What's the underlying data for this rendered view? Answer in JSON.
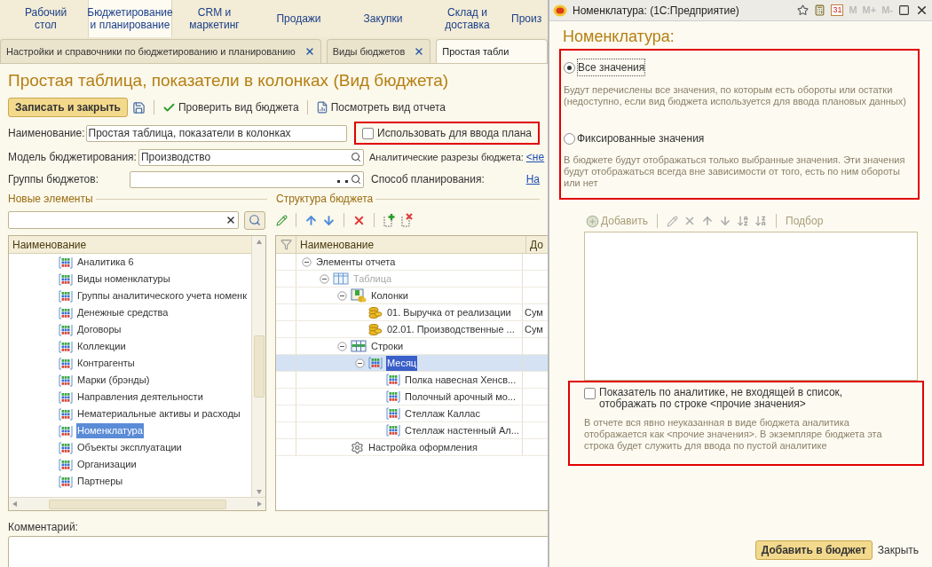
{
  "sections": [
    {
      "label": "Рабочий\nстол",
      "selected": false
    },
    {
      "label": "Бюджетирование\nи планирование",
      "selected": true
    },
    {
      "label": "CRM и\nмаркетинг",
      "selected": false
    },
    {
      "label": "Продажи",
      "selected": false
    },
    {
      "label": "Закупки",
      "selected": false
    },
    {
      "label": "Склад и\nдоставка",
      "selected": false
    },
    {
      "label": "Произ",
      "selected": false
    }
  ],
  "tabs": [
    {
      "label": "Настройки и справочники по бюджетированию и планированию",
      "closable": true,
      "selected": false
    },
    {
      "label": "Виды  бюджетов",
      "closable": true,
      "selected": false
    },
    {
      "label": "Простая табли",
      "closable": false,
      "selected": true
    }
  ],
  "form": {
    "title": "Простая таблица, показатели в колонках (Вид бюджета)",
    "toolbar": {
      "save_close": "Записать и закрыть",
      "check": "Проверить вид бюджета",
      "view": "Посмотреть вид отчета"
    },
    "name": {
      "label": "Наименование:",
      "value": "Простая таблица, показатели в колонках"
    },
    "use_for_plan": {
      "label": "Использовать для ввода плана",
      "checked": false
    },
    "model": {
      "label": "Модель бюджетирования:",
      "value": "Производство"
    },
    "analytics": {
      "label": "Аналитические разрезы бюджета:",
      "link": "<не"
    },
    "group": {
      "label": "Группы бюджетов:"
    },
    "planning": {
      "label": "Способ планирования:",
      "link": "На"
    },
    "comment": {
      "label": "Комментарий:"
    }
  },
  "new_elements": {
    "heading": "Новые элементы",
    "column": "Наименование",
    "items": [
      {
        "label": "Аналитика 6",
        "selected": false
      },
      {
        "label": "Виды номенклатуры",
        "selected": false
      },
      {
        "label": "Группы аналитического учета номенк",
        "selected": false
      },
      {
        "label": "Денежные средства",
        "selected": false
      },
      {
        "label": "Договоры",
        "selected": false
      },
      {
        "label": "Коллекции",
        "selected": false
      },
      {
        "label": "Контрагенты",
        "selected": false
      },
      {
        "label": "Марки (брэнды)",
        "selected": false
      },
      {
        "label": "Направления деятельности",
        "selected": false
      },
      {
        "label": "Нематериальные активы и расходы",
        "selected": false
      },
      {
        "label": "Номенклатура",
        "selected": true
      },
      {
        "label": "Объекты эксплуатации",
        "selected": false
      },
      {
        "label": "Организации",
        "selected": false
      },
      {
        "label": "Партнеры",
        "selected": false
      }
    ]
  },
  "structure": {
    "heading": "Структура бюджета",
    "columns": [
      "Наименование",
      "До"
    ],
    "rows": [
      {
        "label": "Элементы отчета",
        "expanded": true,
        "disabled": false,
        "selected": false,
        "children": [
          {
            "label": "Таблица",
            "kind": "table",
            "expanded": true,
            "disabled": true,
            "selected": false,
            "children": [
              {
                "label": "Колонки",
                "kind": "columns",
                "expanded": true,
                "disabled": false,
                "selected": false,
                "children": [
                  {
                    "label": "01. Выручка от реализации",
                    "kind": "indicator",
                    "column_2": "Сум",
                    "disabled": false,
                    "selected": false
                  },
                  {
                    "label": "02.01. Производственные ...",
                    "kind": "indicator",
                    "column_2": "Сум",
                    "disabled": false,
                    "selected": false
                  }
                ]
              },
              {
                "label": "Строки",
                "kind": "rows",
                "expanded": true,
                "disabled": false,
                "selected": false,
                "children": [
                  {
                    "label": "Месяц",
                    "kind": "analytics",
                    "expanded": true,
                    "disabled": false,
                    "selected": true,
                    "children": [
                      {
                        "label": "Полка навесная Хенсв...",
                        "kind": "analytics",
                        "disabled": false,
                        "selected": false
                      },
                      {
                        "label": "Полочный арочный мо...",
                        "kind": "analytics",
                        "disabled": false,
                        "selected": false
                      },
                      {
                        "label": "Стеллаж Каллас",
                        "kind": "analytics",
                        "disabled": false,
                        "selected": false
                      },
                      {
                        "label": "Стеллаж настенный Ал...",
                        "kind": "analytics",
                        "disabled": false,
                        "selected": false
                      }
                    ]
                  }
                ]
              },
              {
                "label": "Настройка оформления",
                "kind": "settings",
                "disabled": false,
                "selected": false
              }
            ]
          }
        ]
      }
    ]
  },
  "dialog": {
    "title": "Номенклатура:  (1С:Предприятие)",
    "calendar_day": "31",
    "memory_buttons": [
      "M",
      "M+",
      "M-"
    ],
    "heading": "Номенклатура:",
    "options": [
      {
        "label": "Все значения",
        "selected": true,
        "description": "Будут перечислены все значения, по которым есть обороты или остатки (недоступно, если вид бюджета используется для ввода плановых данных)"
      },
      {
        "label": "Фиксированные значения",
        "selected": false,
        "description": "В бюджете будут отображаться только выбранные значения. Эти значения будут отображаться всегда вне зависимости от того, есть по ним обороты или нет"
      }
    ],
    "toolbar": {
      "add": "Добавить",
      "pick": "Подбор"
    },
    "other": {
      "label": "Показатель по аналитике, не входящей в список, отображать по строке <прочие значения>",
      "checked": false,
      "description": "В отчете вся явно неуказанная в виде бюджета аналитика отображается как <прочие значения>. В экземпляре бюджета эта строка будет служить для ввода по пустой аналитике"
    },
    "buttons": [
      {
        "label": "Добавить в бюджет",
        "kind": "primary"
      },
      {
        "label": "Закрыть",
        "kind": "link"
      }
    ]
  }
}
